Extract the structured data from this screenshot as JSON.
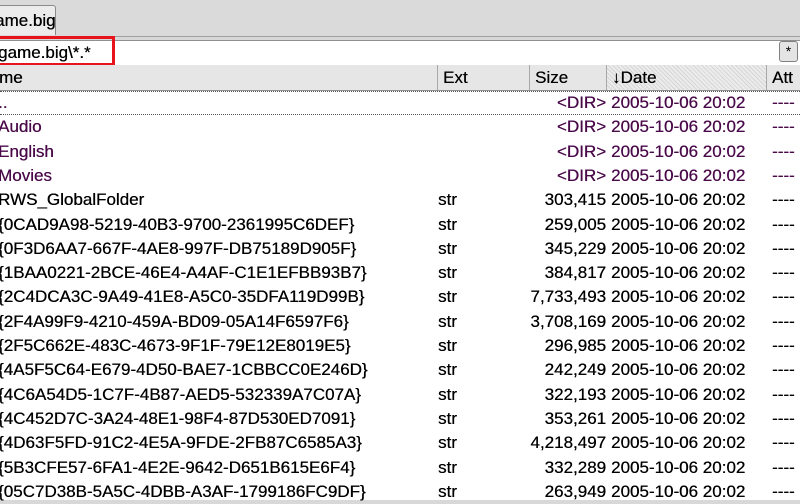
{
  "tab": {
    "label": "ame.big"
  },
  "path": {
    "text": "game.big\\*.*",
    "star_button": "*"
  },
  "columns": {
    "name": "me",
    "ext": "Ext",
    "size": "Size",
    "date": "↓Date",
    "attr": "Att"
  },
  "colors": {
    "dir_text": "#4a0a4a",
    "highlight": "#e8141c"
  },
  "files": [
    {
      "name": "..",
      "ext": "",
      "size": "<DIR>",
      "date": "2005-10-06 20:02",
      "attr": "----",
      "dir": true
    },
    {
      "name": "Audio",
      "ext": "",
      "size": "<DIR>",
      "date": "2005-10-06 20:02",
      "attr": "----",
      "dir": true
    },
    {
      "name": "English",
      "ext": "",
      "size": "<DIR>",
      "date": "2005-10-06 20:02",
      "attr": "----",
      "dir": true
    },
    {
      "name": "Movies",
      "ext": "",
      "size": "<DIR>",
      "date": "2005-10-06 20:02",
      "attr": "----",
      "dir": true
    },
    {
      "name": "RWS_GlobalFolder",
      "ext": "str",
      "size": "303,415",
      "date": "2005-10-06 20:02",
      "attr": "----"
    },
    {
      "name": "{0CAD9A98-5219-40B3-9700-2361995C6DEF}",
      "ext": "str",
      "size": "259,005",
      "date": "2005-10-06 20:02",
      "attr": "----"
    },
    {
      "name": "{0F3D6AA7-667F-4AE8-997F-DB75189D905F}",
      "ext": "str",
      "size": "345,229",
      "date": "2005-10-06 20:02",
      "attr": "----"
    },
    {
      "name": "{1BAA0221-2BCE-46E4-A4AF-C1E1EFBB93B7}",
      "ext": "str",
      "size": "384,817",
      "date": "2005-10-06 20:02",
      "attr": "----"
    },
    {
      "name": "{2C4DCA3C-9A49-41E8-A5C0-35DFA119D99B}",
      "ext": "str",
      "size": "7,733,493",
      "date": "2005-10-06 20:02",
      "attr": "----"
    },
    {
      "name": "{2F4A99F9-4210-459A-BD09-05A14F6597F6}",
      "ext": "str",
      "size": "3,708,169",
      "date": "2005-10-06 20:02",
      "attr": "----"
    },
    {
      "name": "{2F5C662E-483C-4673-9F1F-79E12E8019E5}",
      "ext": "str",
      "size": "296,985",
      "date": "2005-10-06 20:02",
      "attr": "----"
    },
    {
      "name": "{4A5F5C64-E679-4D50-BAE7-1CBBCC0E246D}",
      "ext": "str",
      "size": "242,249",
      "date": "2005-10-06 20:02",
      "attr": "----"
    },
    {
      "name": "{4C6A54D5-1C7F-4B87-AED5-532339A7C07A}",
      "ext": "str",
      "size": "322,193",
      "date": "2005-10-06 20:02",
      "attr": "----"
    },
    {
      "name": "{4C452D7C-3A24-48E1-98F4-87D530ED7091}",
      "ext": "str",
      "size": "353,261",
      "date": "2005-10-06 20:02",
      "attr": "----"
    },
    {
      "name": "{4D63F5FD-91C2-4E5A-9FDE-2FB87C6585A3}",
      "ext": "str",
      "size": "4,218,497",
      "date": "2005-10-06 20:02",
      "attr": "----"
    },
    {
      "name": "{5B3CFE57-6FA1-4E2E-9642-D651B615E6F4}",
      "ext": "str",
      "size": "332,289",
      "date": "2005-10-06 20:02",
      "attr": "----"
    },
    {
      "name": "{05C7D38B-5A5C-4DBB-A3AF-1799186FC9DF}",
      "ext": "str",
      "size": "263,949",
      "date": "2005-10-06 20:02",
      "attr": "----"
    }
  ]
}
